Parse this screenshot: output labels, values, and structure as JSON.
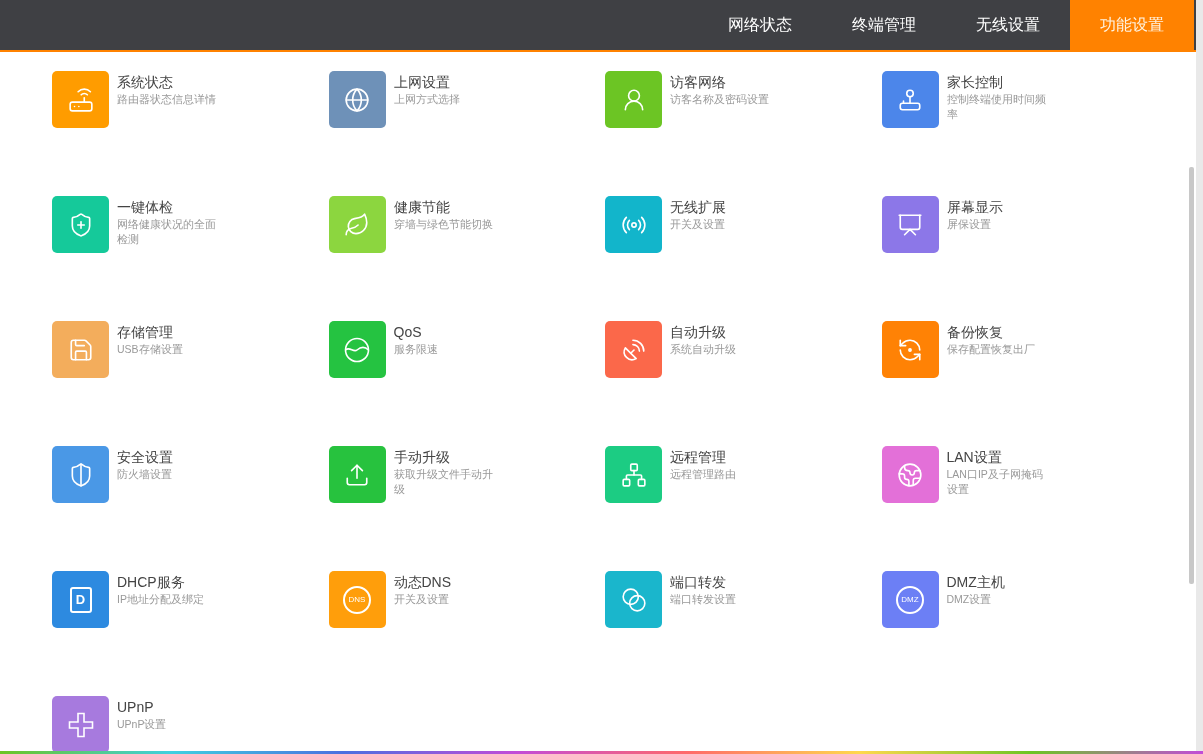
{
  "nav": {
    "tabs": [
      {
        "label": "网络状态",
        "selected": false
      },
      {
        "label": "终端管理",
        "selected": false
      },
      {
        "label": "无线设置",
        "selected": false
      },
      {
        "label": "功能设置",
        "selected": true
      }
    ]
  },
  "features": [
    {
      "title": "系统状态",
      "description": "路由器状态信息详情",
      "color": "#ff9c00"
    },
    {
      "title": "上网设置",
      "description": "上网方式选择",
      "color": "#6e91b8"
    },
    {
      "title": "访客网络",
      "description": "访客名称及密码设置",
      "color": "#6cc524"
    },
    {
      "title": "家长控制",
      "description": "控制终端使用时间频率",
      "color": "#4c86ea"
    },
    {
      "title": "一键体检",
      "description": "网络健康状况的全面检测",
      "color": "#15c99a"
    },
    {
      "title": "健康节能",
      "description": "穿墙与绿色节能切换",
      "color": "#8cd63f"
    },
    {
      "title": "无线扩展",
      "description": "开关及设置",
      "color": "#12b5cb"
    },
    {
      "title": "屏幕显示",
      "description": "屏保设置",
      "color": "#8c77e8"
    },
    {
      "title": "存储管理",
      "description": "USB存储设置",
      "color": "#f3ad5c"
    },
    {
      "title": "QoS",
      "description": "服务限速",
      "color": "#25c341"
    },
    {
      "title": "自动升级",
      "description": "系统自动升级",
      "color": "#fb684a"
    },
    {
      "title": "备份恢复",
      "description": "保存配置恢复出厂",
      "color": "#ff8205"
    },
    {
      "title": "安全设置",
      "description": "防火墙设置",
      "color": "#4a98e6"
    },
    {
      "title": "手动升级",
      "description": "获取升级文件手动升级",
      "color": "#27c23e"
    },
    {
      "title": "远程管理",
      "description": "远程管理路由",
      "color": "#1ccc83"
    },
    {
      "title": "LAN设置",
      "description": "LAN口IP及子网掩码设置",
      "color": "#e370d8"
    },
    {
      "title": "DHCP服务",
      "description": "IP地址分配及绑定",
      "color": "#2d8ae0",
      "icon_text": "D"
    },
    {
      "title": "动态DNS",
      "description": "开关及设置",
      "color": "#ff9e0b",
      "icon_text": "DNS"
    },
    {
      "title": "端口转发",
      "description": "端口转发设置",
      "color": "#1ab6cc"
    },
    {
      "title": "DMZ主机",
      "description": "DMZ设置",
      "color": "#6c7ff5",
      "icon_text": "DMZ"
    },
    {
      "title": "UPnP",
      "description": "UPnP设置",
      "color": "#a77ade"
    }
  ]
}
